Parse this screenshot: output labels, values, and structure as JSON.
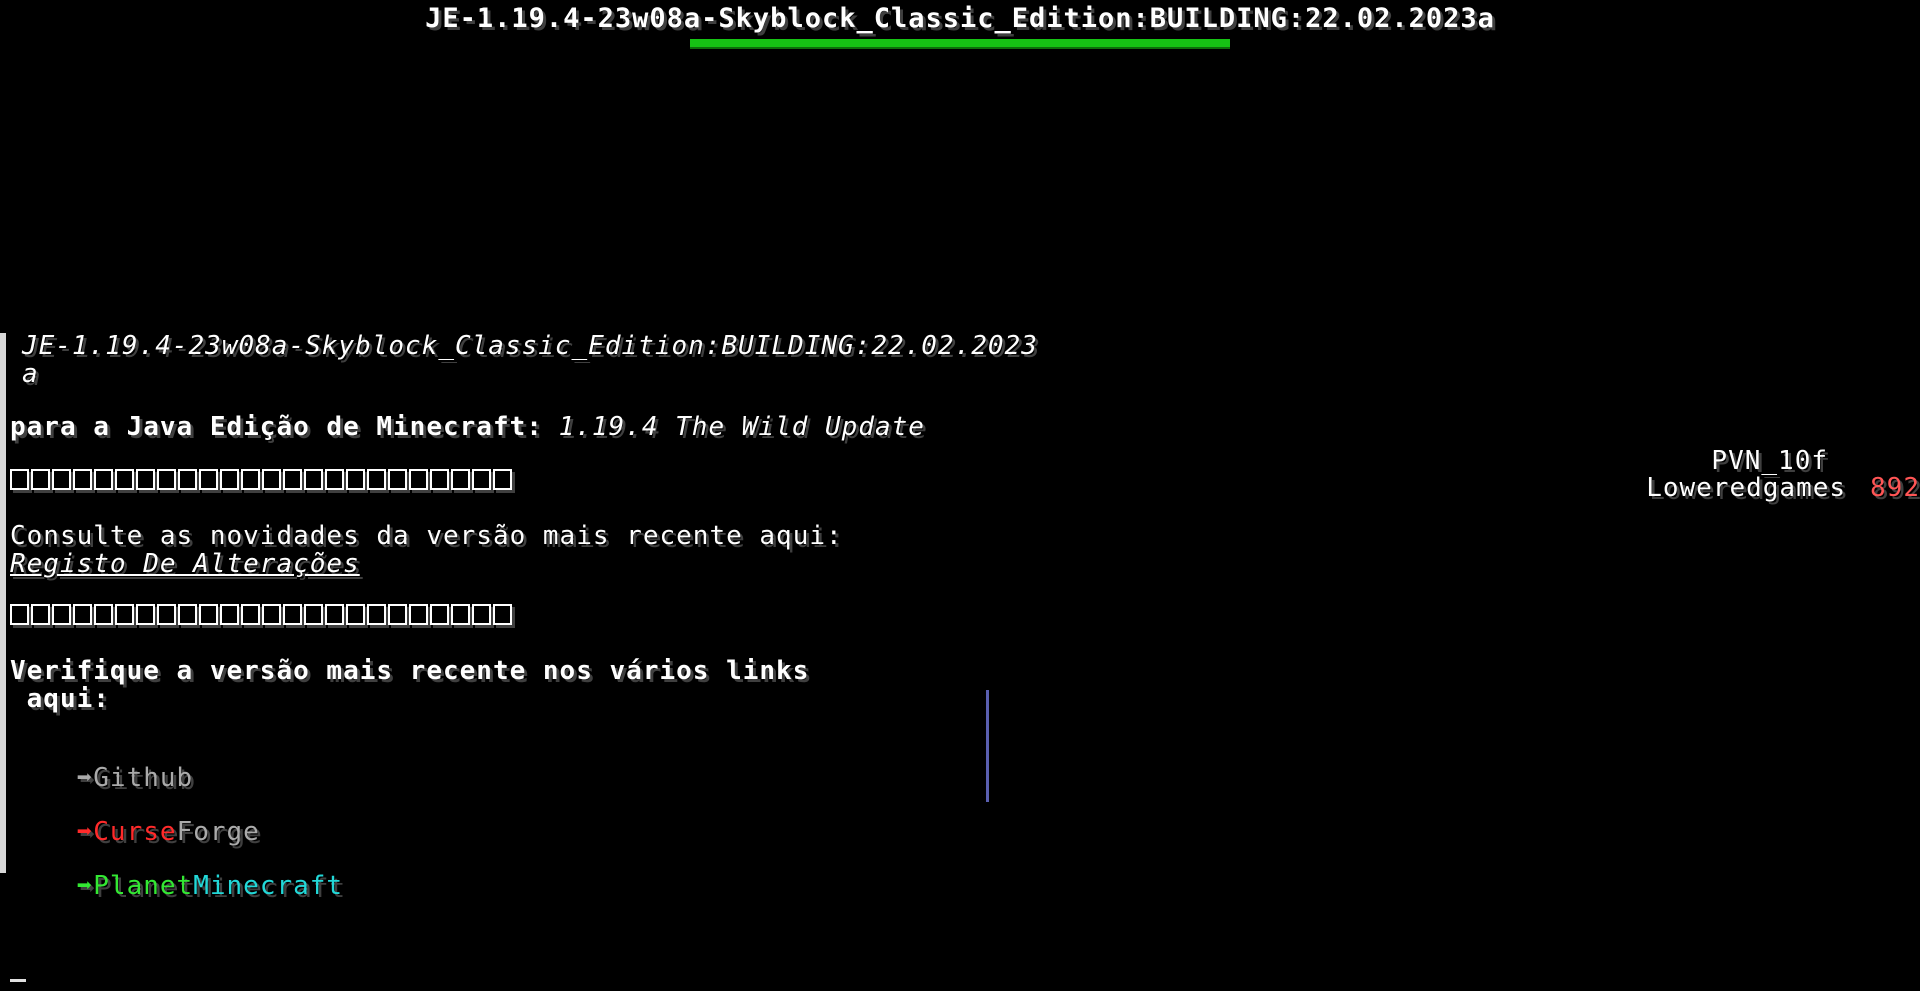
{
  "boss_bar": {
    "title": "JE-1.19.4-23w08a-Skyblock_Classic_Edition:BUILDING:22.02.2023a",
    "progress": 1.0,
    "color": "#16c314"
  },
  "chat": {
    "version_line1": "JE-1.19.4-23w08a-Skyblock_Classic_Edition:BUILDING:22.02.2023",
    "version_line2": "a",
    "for_label": "para a Java Edição de Minecraft:",
    "for_version": "1.19.4 The Wild Update",
    "changelog_text": "Consulte as novidades da versão mais recente aqui:",
    "changelog_link": "Registo De Alterações",
    "links_heading_line1": "Verifique a versão mais recente nos vários links",
    "links_heading_line2": " aqui:",
    "links": [
      {
        "arrow": "➡",
        "part1": "Github",
        "part2": "",
        "arrow_color": "#aaaaaa",
        "color1": "#aaaaaa",
        "color2": ""
      },
      {
        "arrow": "➡",
        "part1": "Curse",
        "part2": "Forge",
        "arrow_color": "#ff2a2a",
        "color1": "#ff2a2a",
        "color2": "#aaaaaa"
      },
      {
        "arrow": "➡",
        "part1": "Planet",
        "part2": "Minecraft",
        "arrow_color": "#33e833",
        "color1": "#33e833",
        "color2": "#22d8d8"
      }
    ]
  },
  "scoreboard": {
    "title": "PVN_10f",
    "player": "Loweredgames",
    "score": "892"
  }
}
